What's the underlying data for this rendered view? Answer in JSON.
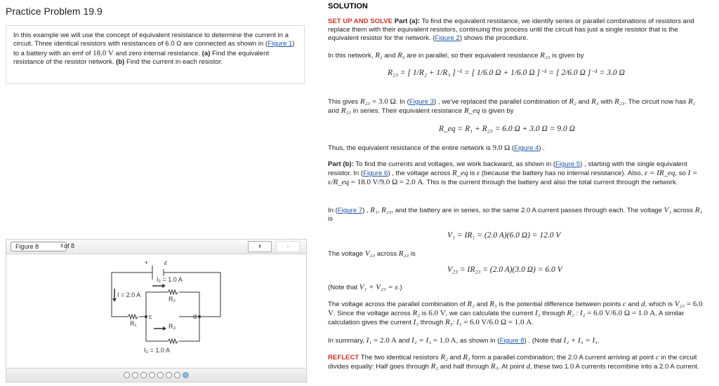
{
  "left": {
    "title": "Practice Problem 19.9",
    "problem": [
      [
        "t",
        "In this example we will use the concept of equivalent resistance to determine the current in a circuit. Three identical resistors with resistances of 6.0 Ω are connected as shown in ("
      ],
      [
        "a",
        "Figure 1"
      ],
      [
        "t",
        ") to a battery with an emf of "
      ],
      [
        "mr",
        "18.0 V"
      ],
      [
        "t",
        " and zero internal resistance. "
      ],
      [
        "b",
        "(a)"
      ],
      [
        "t",
        " Find the equivalent resistance of the resistor network. "
      ],
      [
        "b",
        "(b)"
      ],
      [
        "t",
        " Find the current in each resistor."
      ]
    ],
    "viewer": {
      "selected": "Figure 8",
      "of_label": "of 8",
      "prev": "‹",
      "next": "›",
      "dots": 8,
      "active_dot": 8,
      "labels": {
        "plus": "+",
        "emf": "ε",
        "I": "I = 2.0 A",
        "I2": "I₂ = 1.0 A",
        "I3": "I₃ = 1.0 A",
        "R1": "R₁",
        "R2": "R₂",
        "R3": "R₃",
        "c": "c",
        "d": "d"
      }
    }
  },
  "right": {
    "heading": "SOLUTION",
    "paragraphs": [
      [
        [
          "red",
          "SET UP AND SOLVE "
        ],
        [
          "b",
          "Part (a):"
        ],
        [
          "t",
          " To find the equivalent resistance, we identify series or parallel combinations of resistors and replace them with their equivalent resistors, continuing this process until the circuit has just a single resistor that is the equivalent resistor for the network. ("
        ],
        [
          "a",
          "Figure 2"
        ],
        [
          "t",
          ") shows the procedure."
        ]
      ],
      [
        [
          "t",
          "In this network, "
        ],
        [
          "m",
          "R₂"
        ],
        [
          "t",
          " and "
        ],
        [
          "m",
          "R₃"
        ],
        [
          "t",
          " are in parallel, so their equivalent resistance "
        ],
        [
          "m",
          "R₂₃"
        ],
        [
          "t",
          " is given by"
        ]
      ],
      [
        [
          "t",
          "This gives "
        ],
        [
          "m",
          "R₂₃"
        ],
        [
          "mr",
          " = 3.0 Ω"
        ],
        [
          "t",
          ". In ("
        ],
        [
          "a",
          "Figure 3"
        ],
        [
          "t",
          ") , we've replaced the parallel combination of "
        ],
        [
          "m",
          "R₂"
        ],
        [
          "t",
          " and "
        ],
        [
          "m",
          "R₃"
        ],
        [
          "t",
          " with "
        ],
        [
          "m",
          "R₂₃"
        ],
        [
          "t",
          ". The circuit now has "
        ],
        [
          "m",
          "R₁"
        ],
        [
          "t",
          " and "
        ],
        [
          "m",
          "R₂₃"
        ],
        [
          "t",
          " in series. Their equivalent resistance "
        ],
        [
          "m",
          "R_eq"
        ],
        [
          "t",
          " is given by"
        ]
      ],
      [
        [
          "t",
          "Thus, the equivalent resistance of the entire network is "
        ],
        [
          "mr",
          "9.0 Ω"
        ],
        [
          "t",
          " ("
        ],
        [
          "a",
          "Figure 4"
        ],
        [
          "t",
          ") ."
        ]
      ],
      [
        [
          "b",
          "Part (b):"
        ],
        [
          "t",
          " To find the currents and voltages, we work backward, as shown in ("
        ],
        [
          "a",
          "Figure 5"
        ],
        [
          "t",
          ") , starting with the single equivalent resistor. In ("
        ],
        [
          "a",
          "Figure 6"
        ],
        [
          "t",
          ") , the voltage across "
        ],
        [
          "m",
          "R_eq"
        ],
        [
          "t",
          " is "
        ],
        [
          "m",
          "ε"
        ],
        [
          "t",
          " (because the battery has no internal resistance). Also, "
        ],
        [
          "m",
          "ε = IR_eq"
        ],
        [
          "t",
          ", so "
        ],
        [
          "m",
          "I = ε/R_eq"
        ],
        [
          "mr",
          " = 18.0 V/9.0 Ω = 2.0 A"
        ],
        [
          "t",
          ". This is the current through the battery and also the total current through the network."
        ]
      ],
      [
        [
          "t",
          "In ("
        ],
        [
          "a",
          "Figure 7"
        ],
        [
          "t",
          ") , "
        ],
        [
          "m",
          "R₁"
        ],
        [
          "t",
          ", "
        ],
        [
          "m",
          "R₂₃"
        ],
        [
          "t",
          ", and the battery are in series, so the same 2.0 A current passes through each. The voltage "
        ],
        [
          "m",
          "V₁"
        ],
        [
          "t",
          " across "
        ],
        [
          "m",
          "R₁"
        ],
        [
          "t",
          " is"
        ]
      ],
      [
        [
          "t",
          "The voltage "
        ],
        [
          "m",
          "V₂₃"
        ],
        [
          "t",
          " across "
        ],
        [
          "m",
          "R₂₃"
        ],
        [
          "t",
          " is"
        ]
      ],
      [
        [
          "t",
          "(Note that "
        ],
        [
          "m",
          "V₁ + V₂₃ = ε"
        ],
        [
          "t",
          ".)"
        ]
      ],
      [
        [
          "t",
          "The voltage across the parallel combination of "
        ],
        [
          "m",
          "R₂"
        ],
        [
          "t",
          " and "
        ],
        [
          "m",
          "R₃"
        ],
        [
          "t",
          " is the potential difference between points "
        ],
        [
          "m",
          "c"
        ],
        [
          "t",
          " and "
        ],
        [
          "m",
          "d"
        ],
        [
          "t",
          ", which is "
        ],
        [
          "m",
          "V₂₃"
        ],
        [
          "mr",
          " = 6.0 V"
        ],
        [
          "t",
          ". Since the voltage across "
        ],
        [
          "m",
          "R₂"
        ],
        [
          "t",
          " is "
        ],
        [
          "mr",
          "6.0 V"
        ],
        [
          "t",
          ", we can calculate the current "
        ],
        [
          "m",
          "I₂"
        ],
        [
          "t",
          " through "
        ],
        [
          "m",
          "R₂"
        ],
        [
          "t",
          " : "
        ],
        [
          "m",
          "I₂"
        ],
        [
          "mr",
          " = 6.0 V/6.0 Ω = 1.0 A"
        ],
        [
          "t",
          ". A similar calculation gives the current "
        ],
        [
          "m",
          "I₃"
        ],
        [
          "t",
          " through "
        ],
        [
          "m",
          "R₃"
        ],
        [
          "t",
          ": "
        ],
        [
          "m",
          "I₃"
        ],
        [
          "mr",
          " = 6.0 V/6.0 Ω = 1.0 A"
        ],
        [
          "t",
          "."
        ]
      ],
      [
        [
          "t",
          "In summary, "
        ],
        [
          "m",
          "I₁"
        ],
        [
          "mr",
          " = 2.0 A"
        ],
        [
          "t",
          " and "
        ],
        [
          "m",
          "I₂ = I₃"
        ],
        [
          "mr",
          " = 1.0 A"
        ],
        [
          "t",
          ", as shown in ("
        ],
        [
          "a",
          "Figure 8"
        ],
        [
          "t",
          ") . (Note that "
        ],
        [
          "m",
          "I₂ + I₃ = I₁"
        ],
        [
          "t",
          "."
        ]
      ],
      [
        [
          "red",
          "REFLECT"
        ],
        [
          "t",
          " The two identical resistors "
        ],
        [
          "m",
          "R₂"
        ],
        [
          "t",
          " and "
        ],
        [
          "m",
          "R₃"
        ],
        [
          "t",
          " form a parallel combination; the 2.0 A current arriving at point "
        ],
        [
          "m",
          "c"
        ],
        [
          "t",
          " in the circuit divides equally: Half goes through "
        ],
        [
          "m",
          "R₂"
        ],
        [
          "t",
          " and half through "
        ],
        [
          "m",
          "R₃"
        ],
        [
          "t",
          ". At point "
        ],
        [
          "m",
          "d"
        ],
        [
          "t",
          ", these two 1.0 A currents recombine into a 2.0 A current."
        ]
      ]
    ],
    "equations": {
      "r23": "R₂₃ = [ 1/R₂ + 1/R₃ ]⁻¹ = [ 1/6.0 Ω + 1/6.0 Ω ]⁻¹ = [ 2/6.0 Ω ]⁻¹ = 3.0 Ω",
      "req": "R_eq = R₁ + R₂₃ = 6.0 Ω + 3.0 Ω = 9.0 Ω",
      "v1": "V₁ = IR₁ = (2.0 A)(6.0 Ω) = 12.0 V",
      "v23": "V₂₃ = IR₂₃ = (2.0 A)(3.0 Ω) = 6.0 V"
    }
  }
}
